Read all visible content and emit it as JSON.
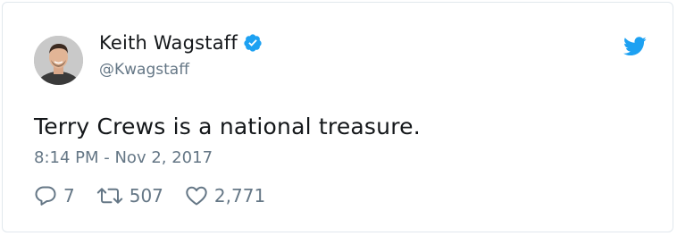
{
  "author": {
    "display_name": "Keith Wagstaff",
    "handle": "@Kwagstaff",
    "verified": true,
    "avatar_icon": "person-photo"
  },
  "tweet": {
    "text": "Terry Crews is a national treasure.",
    "timestamp": "8:14 PM - Nov 2, 2017"
  },
  "actions": {
    "replies": "7",
    "retweets": "507",
    "likes": "2,771"
  },
  "icons": {
    "reply": "speech-bubble-icon",
    "retweet": "retweet-arrows-icon",
    "like": "heart-icon",
    "brand": "twitter-bird-icon",
    "verified": "verified-badge-icon"
  },
  "colors": {
    "brand": "#1da1f2",
    "text": "#14171a",
    "muted": "#657786",
    "border": "#e1e8ed"
  }
}
